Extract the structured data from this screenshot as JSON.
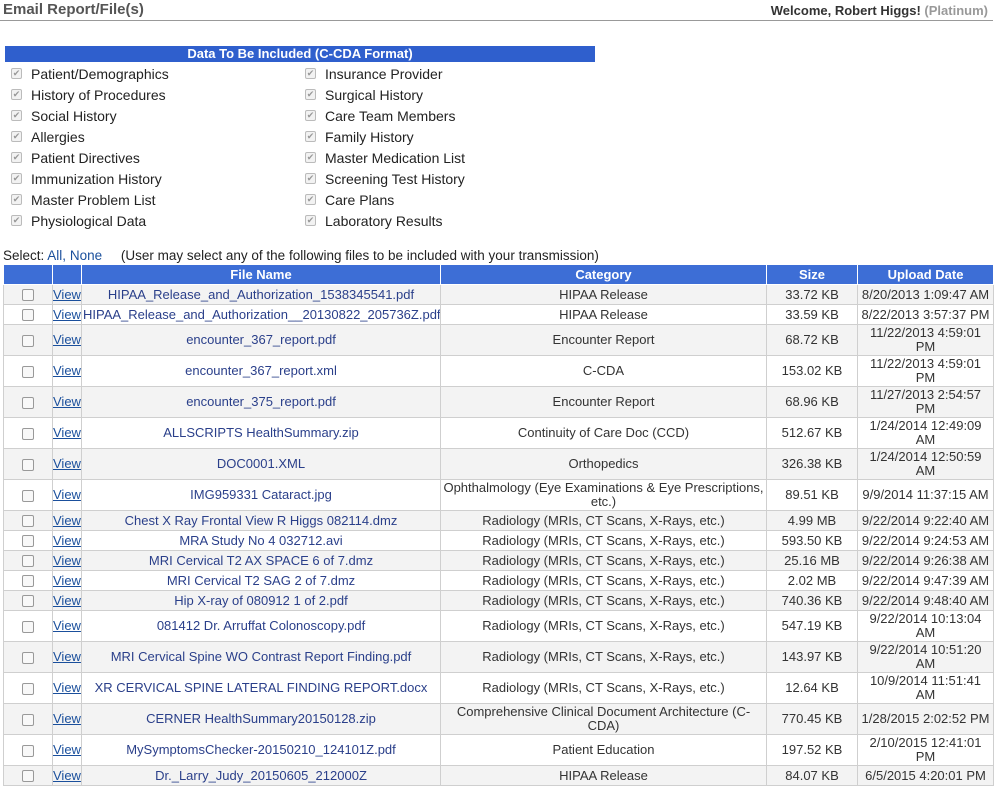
{
  "header": {
    "title": "Email Report/File(s)",
    "welcome": "Welcome, Robert Higgs!",
    "plan": "Platinum",
    "plan_open": "(",
    "plan_close": ")"
  },
  "data_section": {
    "heading": "Data To Be Included (C-CDA Format)",
    "left_items": [
      "Patient/Demographics",
      "History of Procedures",
      "Social History",
      "Allergies",
      "Patient Directives",
      "Immunization History",
      "Master Problem List",
      "Physiological Data"
    ],
    "right_items": [
      "Insurance Provider",
      "Surgical History",
      "Care Team Members",
      "Family History",
      "Master Medication List",
      "Screening Test History",
      "Care Plans",
      "Laboratory Results"
    ],
    "check_glyph": "✔"
  },
  "select": {
    "label": "Select:",
    "all": "All,",
    "none": "None",
    "note": "(User may select any of the following files to be included with your transmission)"
  },
  "table": {
    "columns": [
      "",
      "",
      "File Name",
      "Category",
      "Size",
      "Upload Date"
    ],
    "view_label": "View",
    "rows": [
      {
        "name": "HIPAA_Release_and_Authorization_1538345541.pdf",
        "category": "HIPAA Release",
        "size": "33.72 KB",
        "date": "8/20/2013 1:09:47 AM"
      },
      {
        "name": "HIPAA_Release_and_Authorization__20130822_205736Z.pdf",
        "category": "HIPAA Release",
        "size": "33.59 KB",
        "date": "8/22/2013 3:57:37 PM"
      },
      {
        "name": "encounter_367_report.pdf",
        "category": "Encounter Report",
        "size": "68.72 KB",
        "date": "11/22/2013 4:59:01 PM"
      },
      {
        "name": "encounter_367_report.xml",
        "category": "C-CDA",
        "size": "153.02 KB",
        "date": "11/22/2013 4:59:01 PM"
      },
      {
        "name": "encounter_375_report.pdf",
        "category": "Encounter Report",
        "size": "68.96 KB",
        "date": "11/27/2013 2:54:57 PM"
      },
      {
        "name": "ALLSCRIPTS HealthSummary.zip",
        "category": "Continuity of Care Doc (CCD)",
        "size": "512.67 KB",
        "date": "1/24/2014 12:49:09 AM"
      },
      {
        "name": "DOC0001.XML",
        "category": "Orthopedics",
        "size": "326.38 KB",
        "date": "1/24/2014 12:50:59 AM"
      },
      {
        "name": "IMG959331 Cataract.jpg",
        "category": "Ophthalmology (Eye Examinations & Eye Prescriptions, etc.)",
        "size": "89.51 KB",
        "date": "9/9/2014 11:37:15 AM"
      },
      {
        "name": "Chest X Ray Frontal View R Higgs 082114.dmz",
        "category": "Radiology (MRIs, CT Scans, X-Rays, etc.)",
        "size": "4.99 MB",
        "date": "9/22/2014 9:22:40 AM"
      },
      {
        "name": "MRA Study No 4 032712.avi",
        "category": "Radiology (MRIs, CT Scans, X-Rays, etc.)",
        "size": "593.50 KB",
        "date": "9/22/2014 9:24:53 AM"
      },
      {
        "name": "MRI Cervical T2 AX SPACE 6 of 7.dmz",
        "category": "Radiology (MRIs, CT Scans, X-Rays, etc.)",
        "size": "25.16 MB",
        "date": "9/22/2014 9:26:38 AM"
      },
      {
        "name": "MRI Cervical T2 SAG 2 of 7.dmz",
        "category": "Radiology (MRIs, CT Scans, X-Rays, etc.)",
        "size": "2.02 MB",
        "date": "9/22/2014 9:47:39 AM"
      },
      {
        "name": "Hip X-ray of 080912 1 of 2.pdf",
        "category": "Radiology (MRIs, CT Scans, X-Rays, etc.)",
        "size": "740.36 KB",
        "date": "9/22/2014 9:48:40 AM"
      },
      {
        "name": "081412 Dr. Arruffat Colonoscopy.pdf",
        "category": "Radiology (MRIs, CT Scans, X-Rays, etc.)",
        "size": "547.19 KB",
        "date": "9/22/2014 10:13:04 AM"
      },
      {
        "name": "MRI Cervical Spine WO Contrast Report Finding.pdf",
        "category": "Radiology (MRIs, CT Scans, X-Rays, etc.)",
        "size": "143.97 KB",
        "date": "9/22/2014 10:51:20 AM"
      },
      {
        "name": "XR CERVICAL SPINE LATERAL FINDING REPORT.docx",
        "category": "Radiology (MRIs, CT Scans, X-Rays, etc.)",
        "size": "12.64 KB",
        "date": "10/9/2014 11:51:41 AM"
      },
      {
        "name": "CERNER HealthSummary20150128.zip",
        "category": "Comprehensive Clinical Document Architecture (C-CDA)",
        "size": "770.45 KB",
        "date": "1/28/2015 2:02:52 PM"
      },
      {
        "name": "MySymptomsChecker-20150210_124101Z.pdf",
        "category": "Patient Education",
        "size": "197.52 KB",
        "date": "2/10/2015 12:41:01 PM"
      },
      {
        "name": "Dr._Larry_Judy_20150605_212000Z",
        "category": "HIPAA Release",
        "size": "84.07 KB",
        "date": "6/5/2015 4:20:01 PM"
      }
    ]
  }
}
